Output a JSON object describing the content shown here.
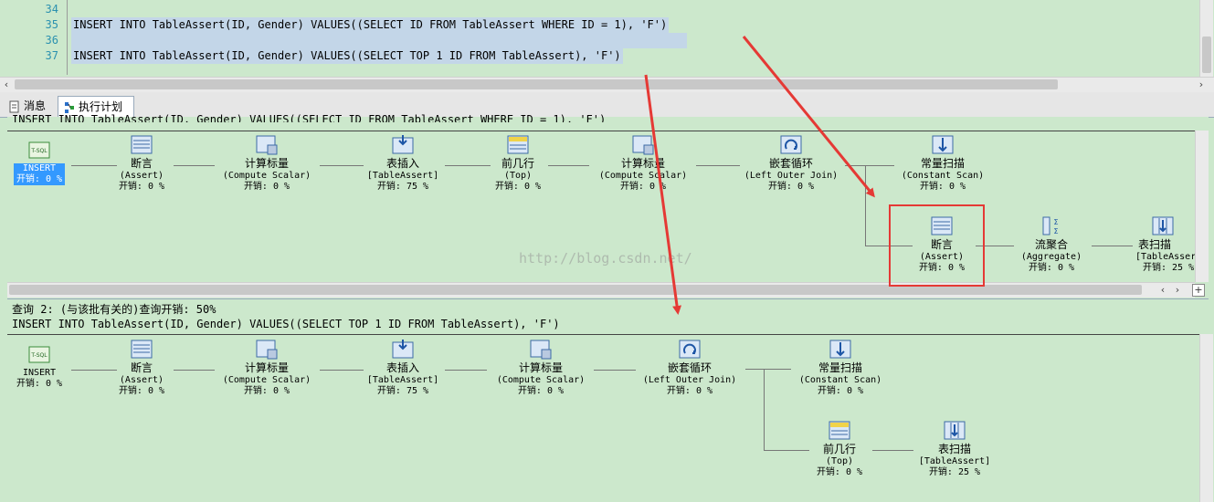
{
  "editor": {
    "lines": [
      {
        "num": "34",
        "code": ""
      },
      {
        "num": "35",
        "code": "INSERT INTO TableAssert(ID, Gender) VALUES((SELECT ID FROM TableAssert WHERE ID = 1), 'F')"
      },
      {
        "num": "36",
        "code": ""
      },
      {
        "num": "37",
        "code": "INSERT INTO TableAssert(ID, Gender) VALUES((SELECT TOP 1 ID FROM TableAssert), 'F')"
      }
    ]
  },
  "tabs": [
    {
      "label": "消息",
      "icon": "messages-icon"
    },
    {
      "label": "执行计划",
      "icon": "execution-plan-icon"
    }
  ],
  "plan1": {
    "header": "INSERT INTO TableAssert(ID, Gender) VALUES((SELECT ID FROM TableAssert WHERE ID = 1), 'F')",
    "nodes": {
      "insert": {
        "name": "INSERT",
        "sub": "",
        "cost": "开销: 0 %"
      },
      "assert": {
        "name": "断言",
        "sub": "(Assert)",
        "cost": "开销: 0 %"
      },
      "compute1": {
        "name": "计算标量",
        "sub": "(Compute Scalar)",
        "cost": "开销: 0 %"
      },
      "tinsert": {
        "name": "表插入",
        "sub": "[TableAssert]",
        "cost": "开销: 75 %"
      },
      "top": {
        "name": "前几行",
        "sub": "(Top)",
        "cost": "开销: 0 %"
      },
      "compute2": {
        "name": "计算标量",
        "sub": "(Compute Scalar)",
        "cost": "开销: 0 %"
      },
      "loop": {
        "name": "嵌套循环",
        "sub": "(Left Outer Join)",
        "cost": "开销: 0 %"
      },
      "const": {
        "name": "常量扫描",
        "sub": "(Constant Scan)",
        "cost": "开销: 0 %"
      },
      "assert2": {
        "name": "断言",
        "sub": "(Assert)",
        "cost": "开销: 0 %"
      },
      "agg": {
        "name": "流聚合",
        "sub": "(Aggregate)",
        "cost": "开销: 0 %"
      },
      "scan": {
        "name": "表扫描",
        "sub": "[TableAssert]",
        "cost": "开销: 25 %"
      }
    }
  },
  "plan2": {
    "query_line": "查询 2: (与该批有关的)查询开销: 50%",
    "header": "INSERT INTO TableAssert(ID, Gender) VALUES((SELECT TOP 1 ID FROM TableAssert), 'F')",
    "nodes": {
      "insert": {
        "name": "INSERT",
        "sub": "",
        "cost": "开销: 0 %"
      },
      "assert": {
        "name": "断言",
        "sub": "(Assert)",
        "cost": "开销: 0 %"
      },
      "compute1": {
        "name": "计算标量",
        "sub": "(Compute Scalar)",
        "cost": "开销: 0 %"
      },
      "tinsert": {
        "name": "表插入",
        "sub": "[TableAssert]",
        "cost": "开销: 75 %"
      },
      "compute2": {
        "name": "计算标量",
        "sub": "(Compute Scalar)",
        "cost": "开销: 0 %"
      },
      "loop": {
        "name": "嵌套循环",
        "sub": "(Left Outer Join)",
        "cost": "开销: 0 %"
      },
      "const": {
        "name": "常量扫描",
        "sub": "(Constant Scan)",
        "cost": "开销: 0 %"
      },
      "top": {
        "name": "前几行",
        "sub": "(Top)",
        "cost": "开销: 0 %"
      },
      "scan": {
        "name": "表扫描",
        "sub": "[TableAssert]",
        "cost": "开销: 25 %"
      }
    }
  },
  "watermark": "http://blog.csdn.net/",
  "colors": {
    "background": "#cce8cc",
    "selection": "#3399ff",
    "annotation": "#e53935"
  }
}
